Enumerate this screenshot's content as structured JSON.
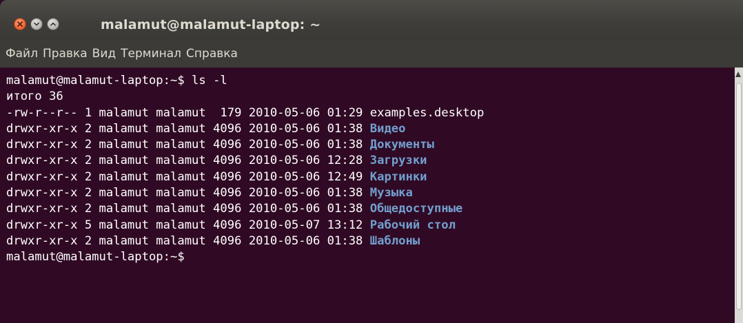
{
  "window": {
    "title": "malamut@malamut-laptop: ~"
  },
  "menu": {
    "items": [
      "Файл",
      "Правка",
      "Вид",
      "Терминал",
      "Справка"
    ]
  },
  "terminal": {
    "prompt_line": "malamut@malamut-laptop:~$ ls -l",
    "total_line": "итого 36",
    "entries": [
      {
        "meta": "-rw-r--r-- 1 malamut malamut  179 2010-05-06 01:29 ",
        "name": "examples.desktop",
        "is_dir": false
      },
      {
        "meta": "drwxr-xr-x 2 malamut malamut 4096 2010-05-06 01:38 ",
        "name": "Видео",
        "is_dir": true
      },
      {
        "meta": "drwxr-xr-x 2 malamut malamut 4096 2010-05-06 01:38 ",
        "name": "Документы",
        "is_dir": true
      },
      {
        "meta": "drwxr-xr-x 2 malamut malamut 4096 2010-05-06 12:28 ",
        "name": "Загрузки",
        "is_dir": true
      },
      {
        "meta": "drwxr-xr-x 2 malamut malamut 4096 2010-05-06 12:49 ",
        "name": "Картинки",
        "is_dir": true
      },
      {
        "meta": "drwxr-xr-x 2 malamut malamut 4096 2010-05-06 01:38 ",
        "name": "Музыка",
        "is_dir": true
      },
      {
        "meta": "drwxr-xr-x 2 malamut malamut 4096 2010-05-06 01:38 ",
        "name": "Общедоступные",
        "is_dir": true
      },
      {
        "meta": "drwxr-xr-x 5 malamut malamut 4096 2010-05-07 13:12 ",
        "name": "Рабочий стол",
        "is_dir": true
      },
      {
        "meta": "drwxr-xr-x 2 malamut malamut 4096 2010-05-06 01:38 ",
        "name": "Шаблоны",
        "is_dir": true
      }
    ],
    "final_prompt": "malamut@malamut-laptop:~$ "
  },
  "colors": {
    "terminal_background": "#300a24",
    "terminal_text": "#ffffff",
    "directory_text": "#729fcf",
    "titlebar": "#3c3b37",
    "close_button": "#ef6b3e"
  },
  "icons": [
    "close-icon",
    "minimize-icon",
    "maximize-icon"
  ]
}
